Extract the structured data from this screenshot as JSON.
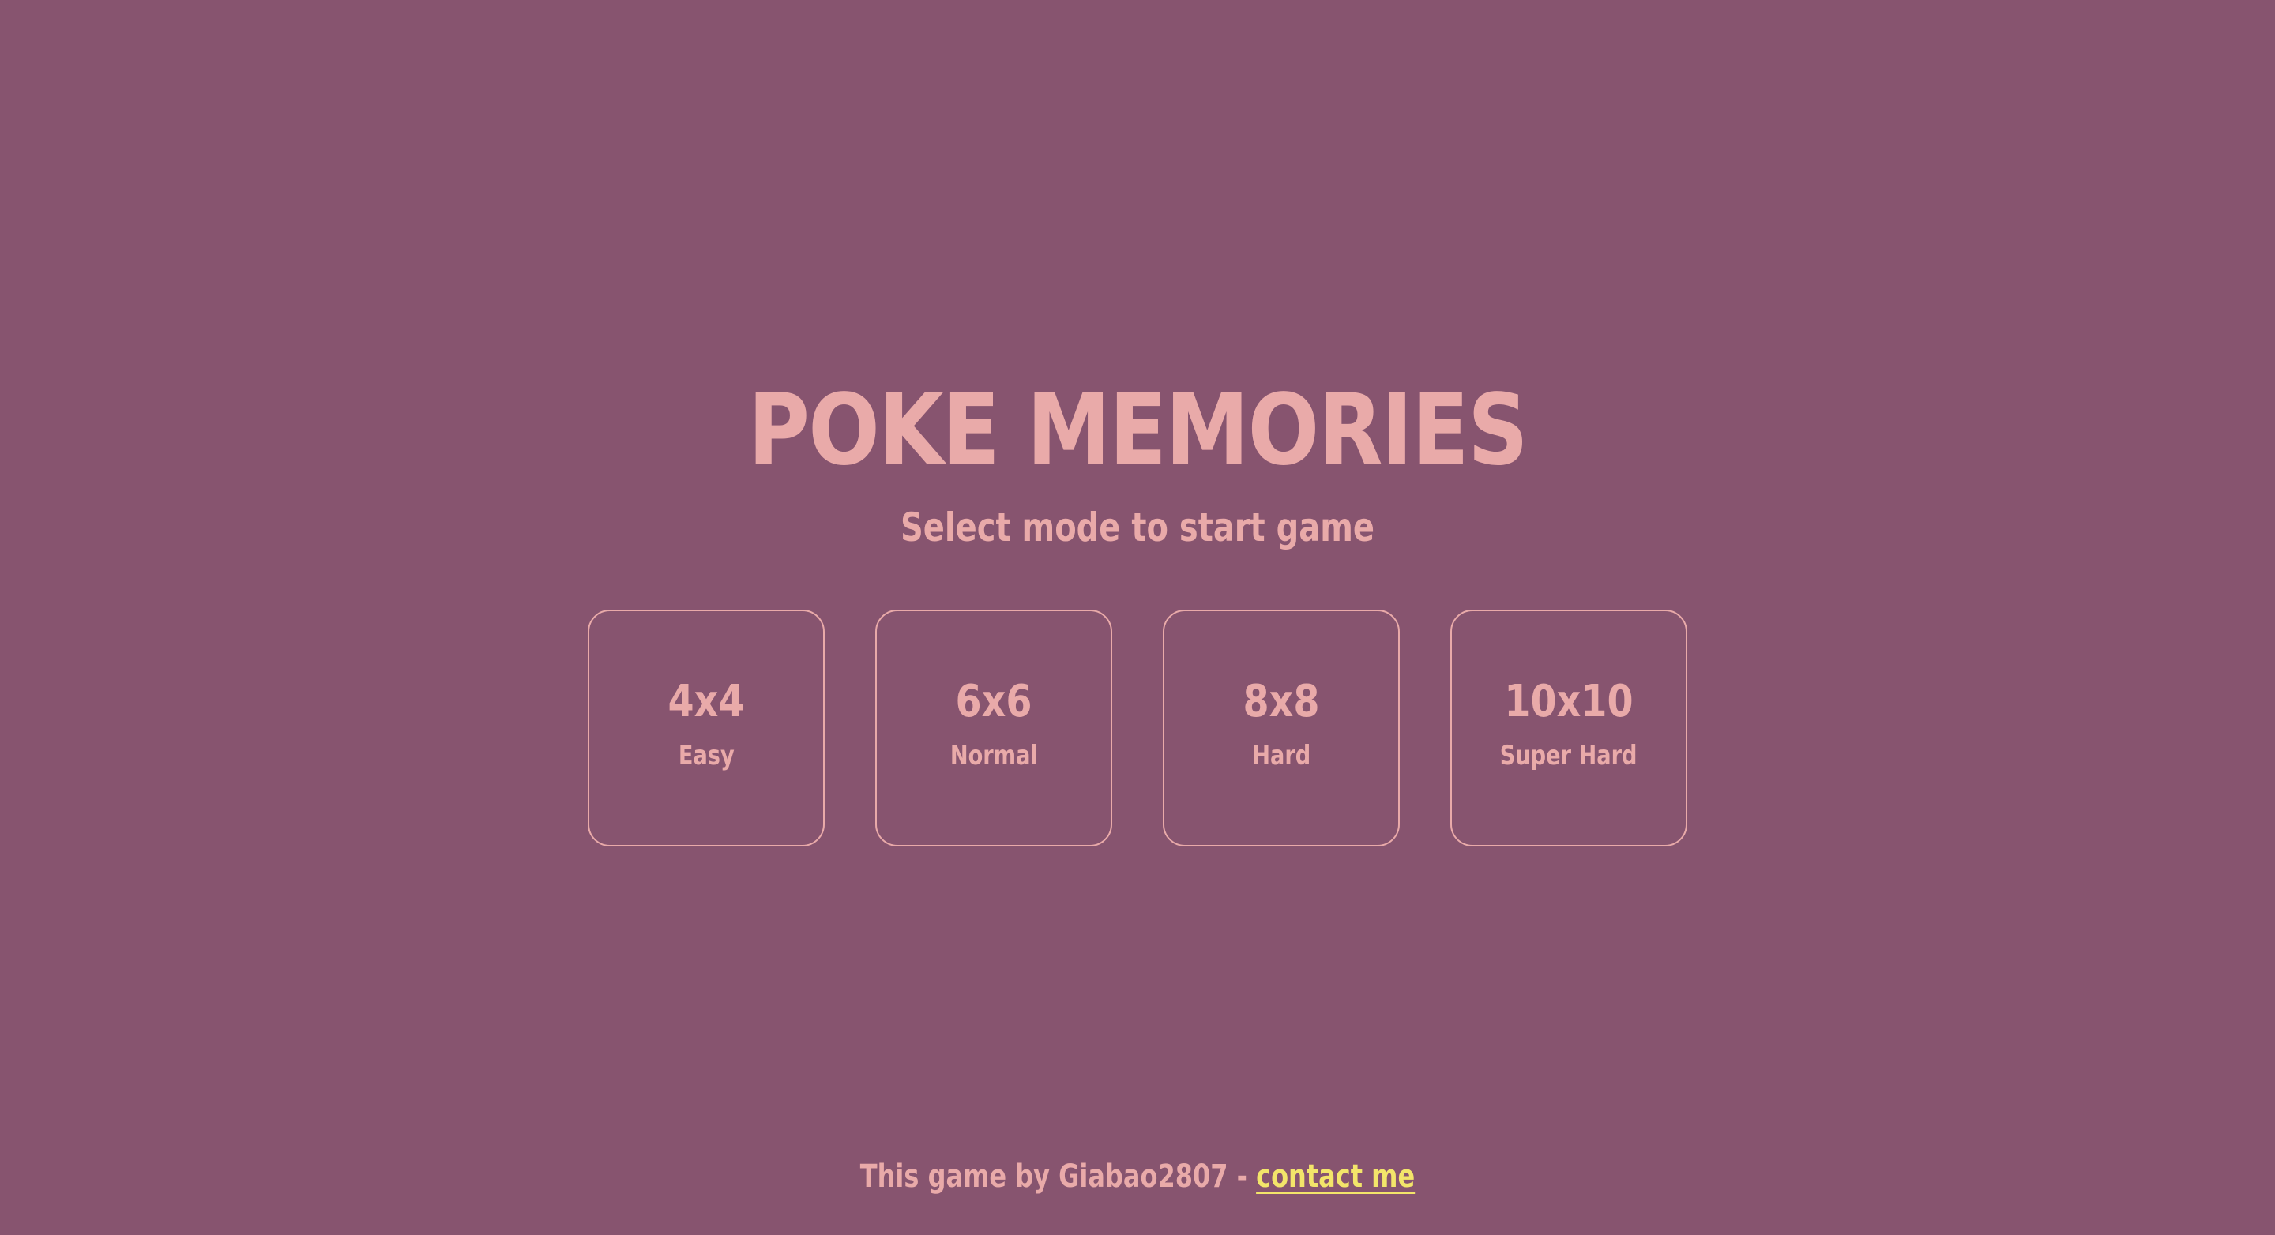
{
  "app": {
    "title": "POKE MEMORIES",
    "subtitle": "Select mode to start game"
  },
  "modes": [
    {
      "size": "4x4",
      "label": "Easy"
    },
    {
      "size": "6x6",
      "label": "Normal"
    },
    {
      "size": "8x8",
      "label": "Hard"
    },
    {
      "size": "10x10",
      "label": "Super Hard"
    }
  ],
  "footer": {
    "credit_text": "This game by Giabao2807 - ",
    "contact_link": "contact me"
  },
  "colors": {
    "background": "#87546f",
    "accent": "#e9aaa9",
    "link": "#f3e56a"
  }
}
